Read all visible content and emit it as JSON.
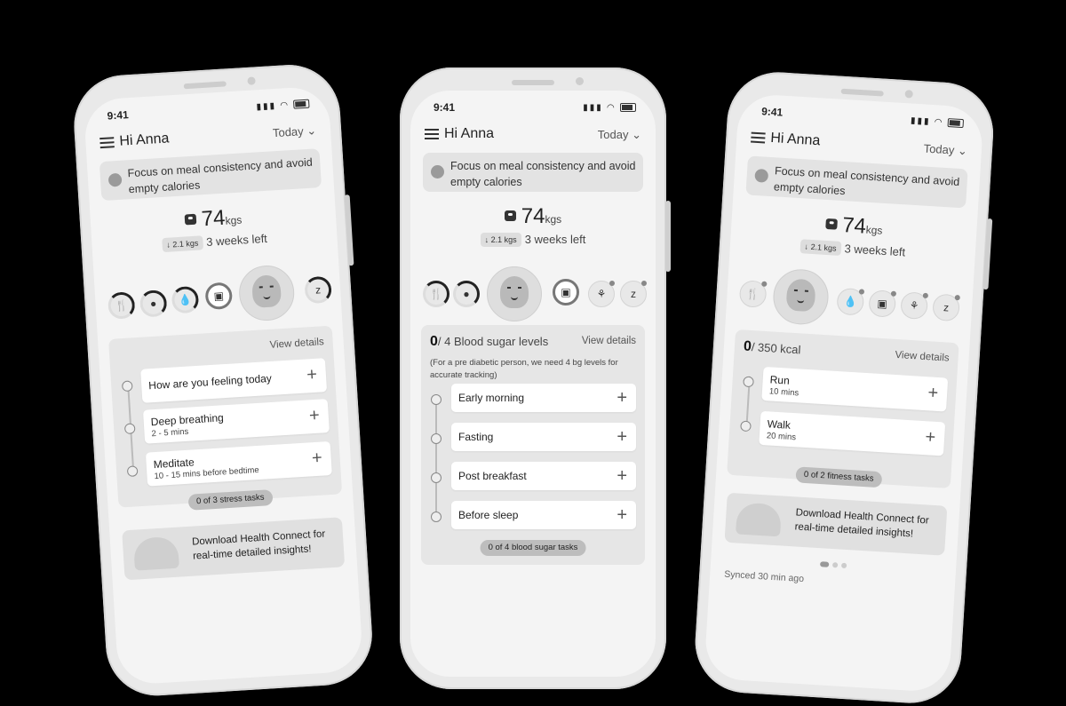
{
  "status_bar": {
    "time": "9:41"
  },
  "phones": [
    {
      "greeting": "Hi Anna",
      "date_selector": "Today",
      "focus_text": "Focus on meal consistency and avoid empty calories",
      "weight": {
        "value": "74",
        "unit": "kgs",
        "change": "2.1 kgs",
        "remaining": "3 weeks left"
      },
      "panel": {
        "view_details": "View details",
        "items": [
          {
            "label": "How are you feeling today",
            "sub": ""
          },
          {
            "label": "Deep breathing",
            "sub": "2 - 5 mins"
          },
          {
            "label": "Meditate",
            "sub": "10 - 15 mins before bedtime"
          }
        ],
        "summary": "0 of 3 stress tasks"
      },
      "promo": "Download Health Connect for real-time detailed insights!"
    },
    {
      "greeting": "Hi Anna",
      "date_selector": "Today",
      "focus_text": "Focus on meal consistency and avoid empty calories",
      "weight": {
        "value": "74",
        "unit": "kgs",
        "change": "2.1 kgs",
        "remaining": "3 weeks left"
      },
      "panel": {
        "count": "0",
        "title_rest": "/ 4 Blood sugar levels",
        "view_details": "View details",
        "note": "(For a pre diabetic person, we need 4 bg levels for accurate tracking)",
        "items": [
          {
            "label": "Early morning"
          },
          {
            "label": "Fasting"
          },
          {
            "label": "Post breakfast"
          },
          {
            "label": "Before sleep"
          }
        ],
        "summary": "0 of 4 blood sugar tasks"
      }
    },
    {
      "greeting": "Hi Anna",
      "date_selector": "Today",
      "focus_text": "Focus on meal consistency and avoid empty calories",
      "weight": {
        "value": "74",
        "unit": "kgs",
        "change": "2.1 kgs",
        "remaining": "3 weeks left"
      },
      "panel": {
        "count": "0",
        "title_rest": "/ 350 kcal",
        "view_details": "View details",
        "items": [
          {
            "label": "Run",
            "sub": "10 mins"
          },
          {
            "label": "Walk",
            "sub": "20 mins"
          }
        ],
        "summary": "0 of 2 fitness tasks"
      },
      "promo": "Download Health Connect for real-time detailed insights!",
      "synced": "Synced 30 min ago"
    }
  ],
  "icons": {
    "meal": "fork-knife-icon",
    "fire": "fire-icon",
    "water": "water-drop-icon",
    "scale": "weight-scale-icon",
    "sleep": "sleep-zzz-icon",
    "meditation": "meditation-icon"
  }
}
